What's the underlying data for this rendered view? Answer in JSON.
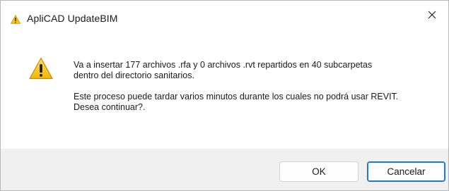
{
  "window": {
    "title": "ApliCAD UpdateBIM",
    "close_symbol": "close-icon"
  },
  "message": {
    "line1": "Va a insertar 177 archivos .rfa y 0 archivos .rvt repartidos en 40 subcarpetas",
    "line2": "dentro del directorio sanitarios.",
    "line3": "Este proceso puede tardar varios minutos durante los cuales no podrá usar REVIT.",
    "line4": "Desea continuar?."
  },
  "buttons": {
    "ok_label": "OK",
    "cancel_label": "Cancelar"
  },
  "colors": {
    "warning_yellow": "#f5c211",
    "focus_border": "#1f6fb5",
    "footer_bg": "#f0f0f0"
  }
}
